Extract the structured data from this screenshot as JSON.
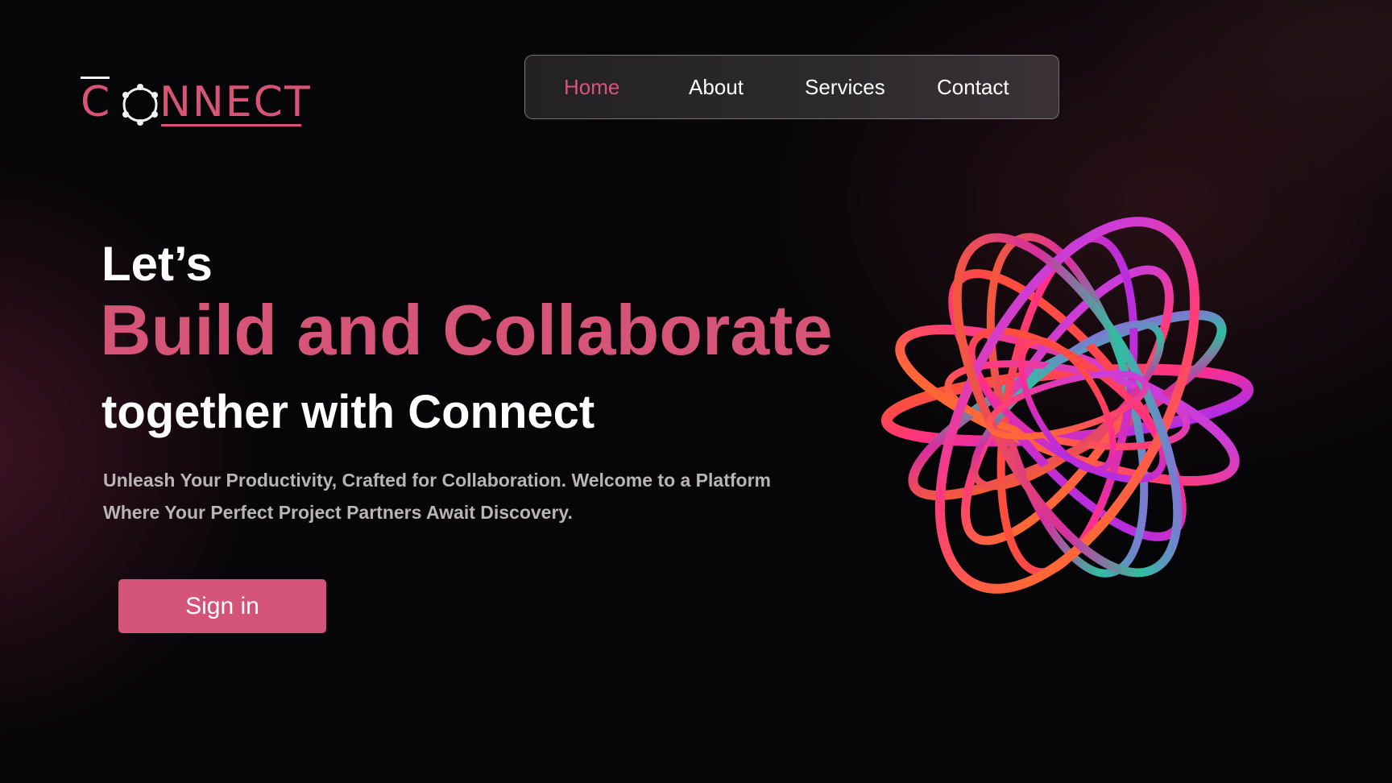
{
  "brand": {
    "logo_initial": "C",
    "logo_rest": "NNECT",
    "accent_color": "#d65478"
  },
  "nav": {
    "items": [
      {
        "label": "Home",
        "active": true
      },
      {
        "label": "About",
        "active": false
      },
      {
        "label": "Services",
        "active": false
      },
      {
        "label": "Contact",
        "active": false
      }
    ]
  },
  "hero": {
    "intro": "Let’s",
    "headline": "Build and Collaborate",
    "subheadline": "together with Connect",
    "description": "Unleash Your Productivity, Crafted for Collaboration. Welcome to a Platform Where Your Perfect Project Partners Await Discovery.",
    "cta_label": "Sign in",
    "art_icon": "abstract-ribbon-sphere-icon"
  }
}
